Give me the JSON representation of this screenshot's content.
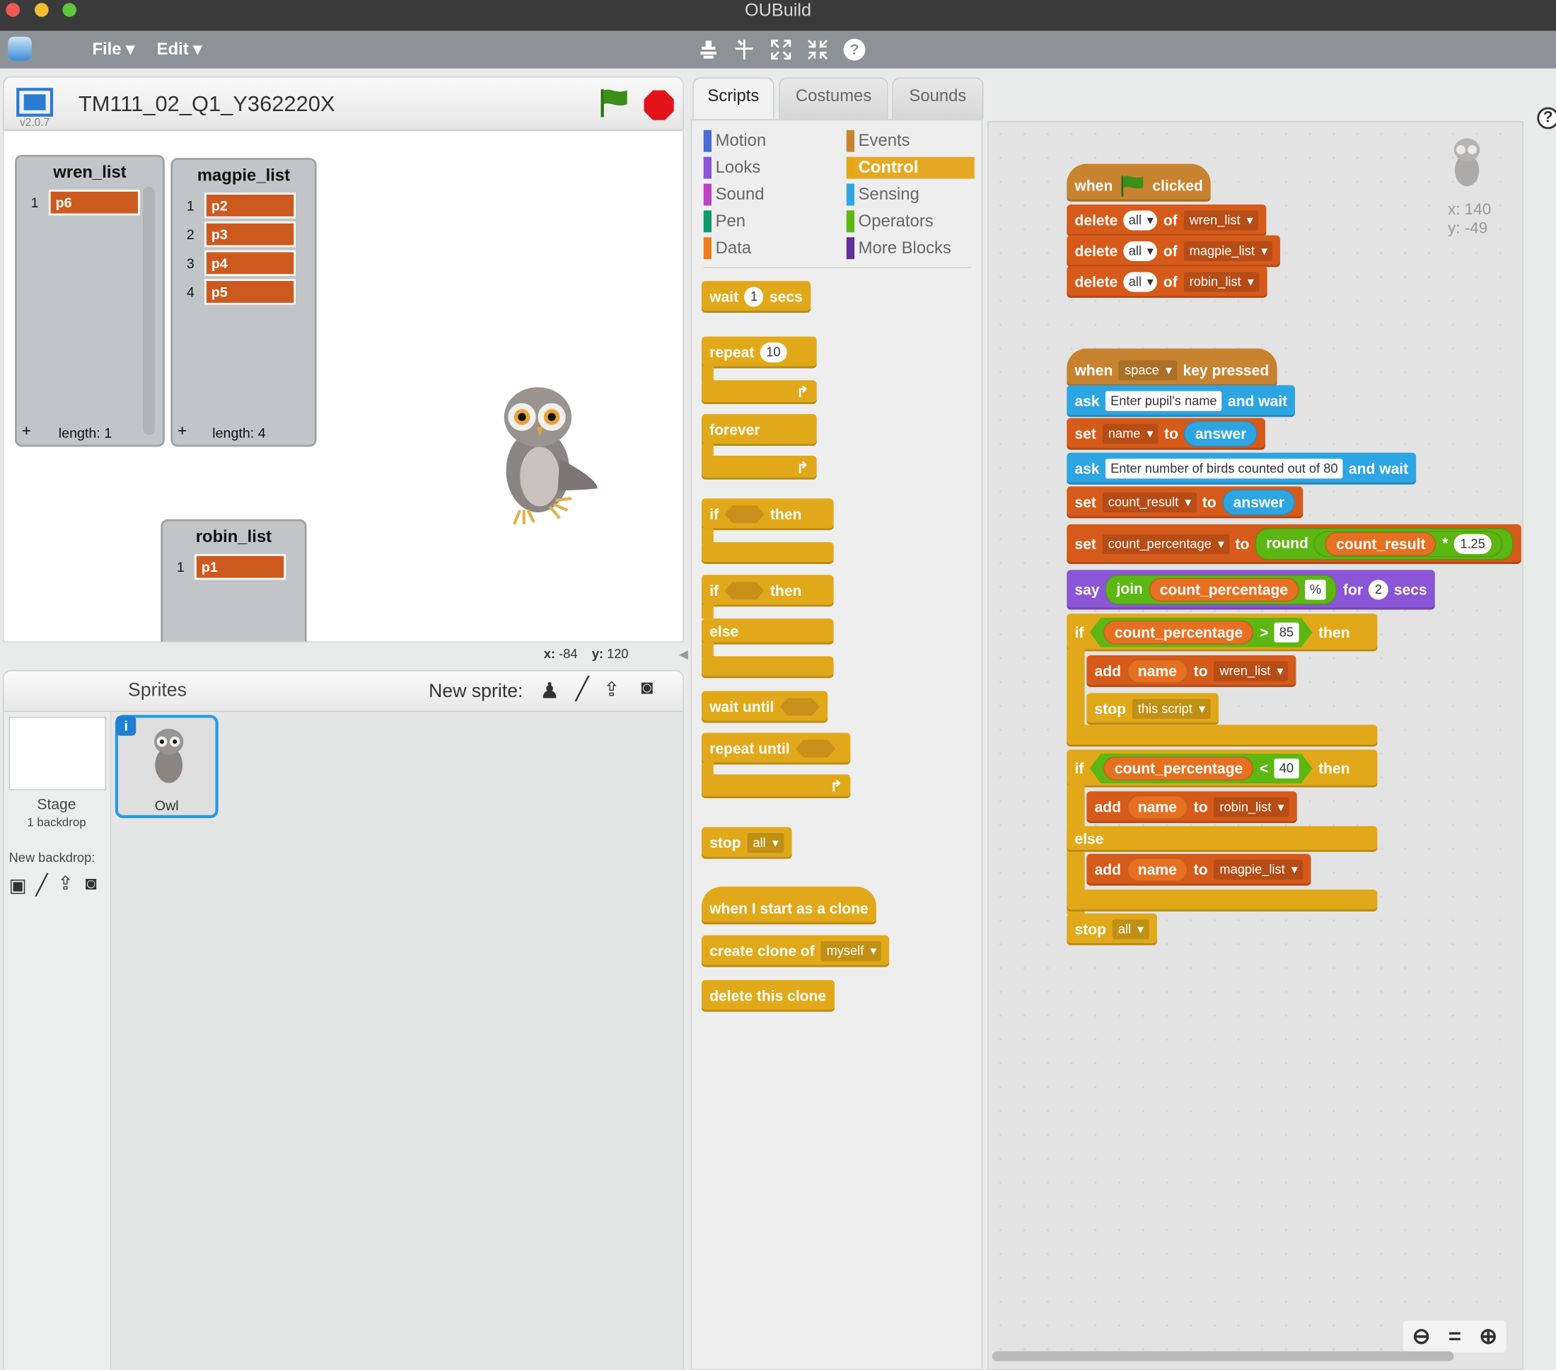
{
  "window": {
    "title": "OUBuild"
  },
  "menu": {
    "file": "File ▾",
    "edit": "Edit ▾"
  },
  "toolbar_icons": [
    "duplicate-icon",
    "delete-icon",
    "grow-icon",
    "shrink-icon",
    "help-icon"
  ],
  "stage": {
    "project_name": "TM111_02_Q1_Y362220X",
    "version": "v2.0.7",
    "coords": {
      "x_label": "x:",
      "x": "-84",
      "y_label": "y:",
      "y": "120"
    },
    "lists": [
      {
        "name": "wren_list",
        "items": [
          "p6"
        ],
        "length": "length: 1"
      },
      {
        "name": "magpie_list",
        "items": [
          "p2",
          "p3",
          "p4",
          "p5"
        ],
        "length": "length: 4"
      },
      {
        "name": "robin_list",
        "items": [
          "p1"
        ]
      }
    ]
  },
  "sprites_panel": {
    "title": "Sprites",
    "new_sprite": "New sprite:",
    "stage_label": "Stage",
    "stage_sub": "1 backdrop",
    "new_backdrop": "New backdrop:",
    "sprite_name": "Owl"
  },
  "tabs": [
    "Scripts",
    "Costumes",
    "Sounds"
  ],
  "categories": [
    {
      "name": "Motion",
      "color": "#4a6cd4"
    },
    {
      "name": "Looks",
      "color": "#8a55d7"
    },
    {
      "name": "Sound",
      "color": "#bb42c3"
    },
    {
      "name": "Pen",
      "color": "#0e9a6c"
    },
    {
      "name": "Data",
      "color": "#ee7d16"
    },
    {
      "name": "Events",
      "color": "#c88330"
    },
    {
      "name": "Control",
      "color": "#e1a91a",
      "selected": true
    },
    {
      "name": "Sensing",
      "color": "#2ca5e2"
    },
    {
      "name": "Operators",
      "color": "#5cb712"
    },
    {
      "name": "More Blocks",
      "color": "#632d99"
    }
  ],
  "palette": {
    "wait": "wait",
    "wait_val": "1",
    "secs": "secs",
    "repeat": "repeat",
    "repeat_val": "10",
    "forever": "forever",
    "if": "if",
    "then": "then",
    "else": "else",
    "wait_until": "wait until",
    "repeat_until": "repeat until",
    "stop": "stop",
    "stop_opt": "all",
    "clone_hat": "when I start as a clone",
    "create_clone": "create clone of",
    "create_clone_opt": "myself",
    "delete_clone": "delete this clone"
  },
  "sprite_info": {
    "x": "x: 140",
    "y": "y: -49"
  },
  "script1": {
    "when": "when",
    "clicked": "clicked",
    "delete": "delete",
    "all": "all",
    "of": "of",
    "lists": [
      "wren_list",
      "magpie_list",
      "robin_list"
    ]
  },
  "script2": {
    "when": "when",
    "key": "space",
    "pressed": "key pressed",
    "ask": "ask",
    "ask1": "Enter pupil's name",
    "and_wait": "and wait",
    "set": "set",
    "to": "to",
    "var_name": "name",
    "answer": "answer",
    "ask2": "Enter number of birds counted out of 80",
    "var_count": "count_result",
    "var_pct": "count_percentage",
    "round": "round",
    "times": "*",
    "factor": "1.25",
    "say": "say",
    "join": "join",
    "pct_sign": "%",
    "for": "for",
    "secs_val": "2",
    "secs": "secs",
    "if": "if",
    "gt": ">",
    "gt_val": "85",
    "then": "then",
    "add": "add",
    "wren": "wren_list",
    "stop": "stop",
    "stop_script": "this script",
    "lt": "<",
    "lt_val": "40",
    "robin": "robin_list",
    "else": "else",
    "magpie": "magpie_list",
    "stop_all": "all"
  }
}
